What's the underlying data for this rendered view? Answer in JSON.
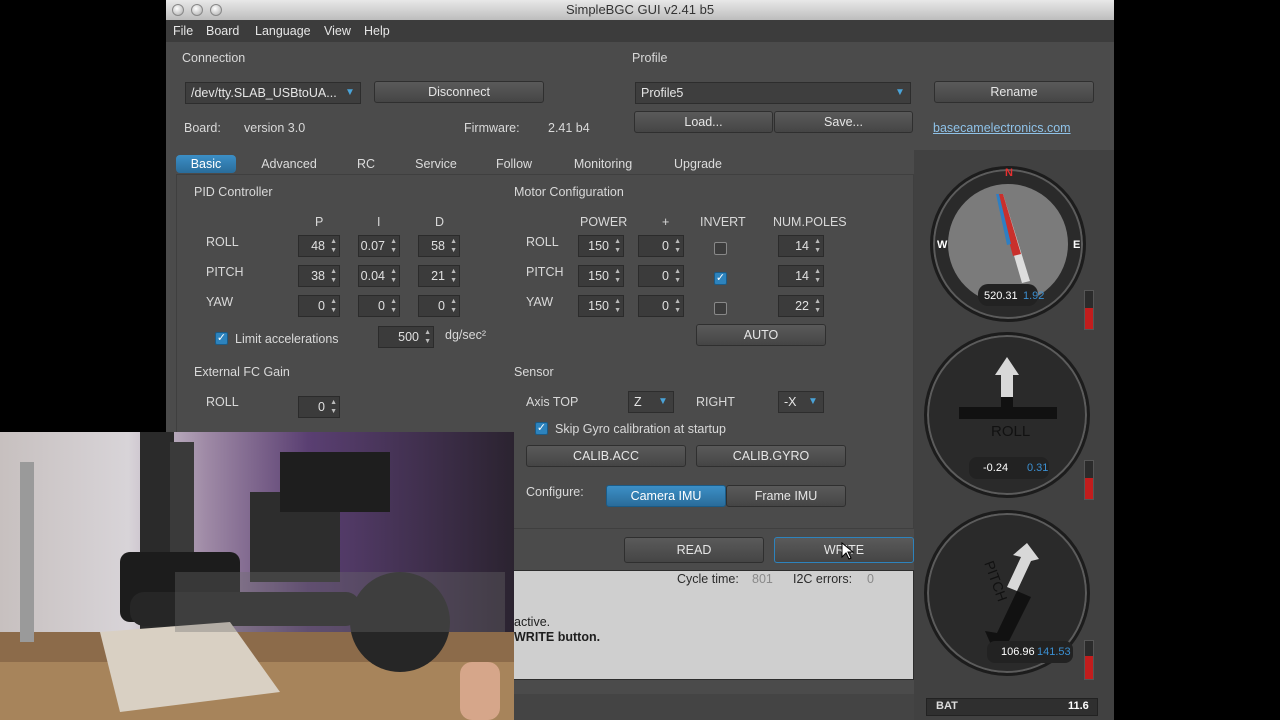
{
  "window": {
    "title": "SimpleBGC GUI v2.41 b5"
  },
  "menu": [
    "File",
    "Board",
    "Language",
    "View",
    "Help"
  ],
  "connection": {
    "heading": "Connection",
    "port": "/dev/tty.SLAB_USBtoUA...",
    "disconnect_label": "Disconnect",
    "board_label": "Board:",
    "board_value": "version 3.0",
    "firmware_label": "Firmware:",
    "firmware_value": "2.41 b4"
  },
  "profile": {
    "heading": "Profile",
    "selected": "Profile5",
    "rename_label": "Rename",
    "load_label": "Load...",
    "save_label": "Save...",
    "link": "basecamelectronics.com"
  },
  "tabs": [
    "Basic",
    "Advanced",
    "RC",
    "Service",
    "Follow",
    "Monitoring",
    "Upgrade"
  ],
  "pid": {
    "heading": "PID Controller",
    "cols": [
      "P",
      "I",
      "D"
    ],
    "rows": [
      {
        "name": "ROLL",
        "p": "48",
        "i": "0.07",
        "d": "58"
      },
      {
        "name": "PITCH",
        "p": "38",
        "i": "0.04",
        "d": "21"
      },
      {
        "name": "YAW",
        "p": "0",
        "i": "0",
        "d": "0"
      }
    ],
    "limit_label": "Limit accelerations",
    "limit_value": "500",
    "limit_unit": "dg/sec²"
  },
  "motor": {
    "heading": "Motor Configuration",
    "cols": [
      "POWER",
      "+",
      "INVERT",
      "NUM.POLES"
    ],
    "rows": [
      {
        "name": "ROLL",
        "power": "150",
        "plus": "0",
        "invert": false,
        "poles": "14"
      },
      {
        "name": "PITCH",
        "power": "150",
        "plus": "0",
        "invert": true,
        "poles": "14"
      },
      {
        "name": "YAW",
        "power": "150",
        "plus": "0",
        "invert": false,
        "poles": "22"
      }
    ],
    "auto_label": "AUTO"
  },
  "external_fc": {
    "heading": "External FC Gain",
    "roll_label": "ROLL",
    "roll_value": "0"
  },
  "sensor": {
    "heading": "Sensor",
    "axis_top_label": "Axis TOP",
    "axis_top_value": "Z",
    "right_label": "RIGHT",
    "right_value": "-X",
    "skip_gyro_label": "Skip Gyro calibration at startup",
    "calib_acc_label": "CALIB.ACC",
    "calib_gyro_label": "CALIB.GYRO",
    "configure_label": "Configure:",
    "camera_imu_label": "Camera IMU",
    "frame_imu_label": "Frame IMU"
  },
  "actions": {
    "read_label": "READ",
    "write_label": "WRITE"
  },
  "status": {
    "cycle_label": "Cycle time:",
    "cycle_value": "801",
    "i2c_label": "I2C errors:",
    "i2c_value": "0",
    "message_line1": "active.",
    "message_line2": "WRITE button."
  },
  "gauges": {
    "compass": {
      "n": "N",
      "w": "W",
      "e": "E",
      "value1": "520.31",
      "value2": "1.92"
    },
    "roll": {
      "label": "ROLL",
      "value1": "-0.24",
      "value2": "0.31"
    },
    "pitch": {
      "label": "PITCH",
      "value1": "106.96",
      "value2": "141.53"
    },
    "bat_label": "BAT",
    "bat_value": "11.6"
  },
  "colors": {
    "accent": "#2d83bd",
    "background": "#4b4b4b",
    "alert": "#c21d1d"
  }
}
